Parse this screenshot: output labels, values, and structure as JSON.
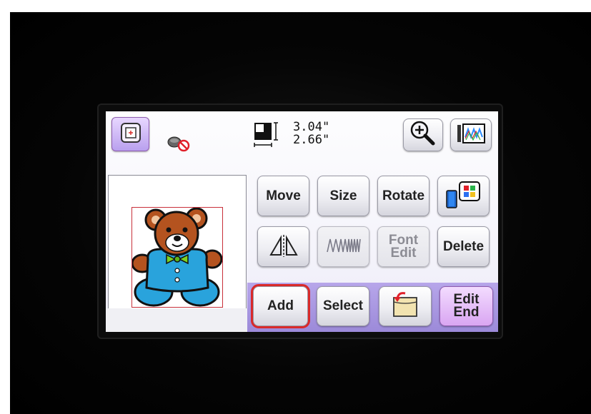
{
  "toolbar": {
    "size_width": "3.04\"",
    "size_height": "2.66\""
  },
  "buttons": {
    "move": "Move",
    "size": "Size",
    "rotate": "Rotate",
    "font_edit_line1": "Font",
    "font_edit_line2": "Edit",
    "delete": "Delete",
    "add": "Add",
    "select": "Select",
    "edit_end_line1": "Edit",
    "edit_end_line2": "End"
  },
  "state": {
    "selected_button": "add"
  },
  "colors": {
    "selection_outline": "#d92a2a",
    "bottom_bar": "#a997e0",
    "edit_end_button": "#e3bdf7",
    "bear_brown": "#b4531f",
    "bear_blue": "#29a3dc",
    "bow_green": "#7ed321"
  },
  "icons": {
    "frame": "embroidery-frame-icon",
    "no_presser_foot": "presser-foot-off-icon",
    "size_indicator": "pattern-size-icon",
    "zoom": "magnifier-plus-icon",
    "preview": "stitch-preview-icon",
    "mirror": "mirror-flip-icon",
    "density": "stitch-density-icon",
    "thread_color": "thread-color-palette-icon",
    "memory": "memory-pocket-icon"
  }
}
